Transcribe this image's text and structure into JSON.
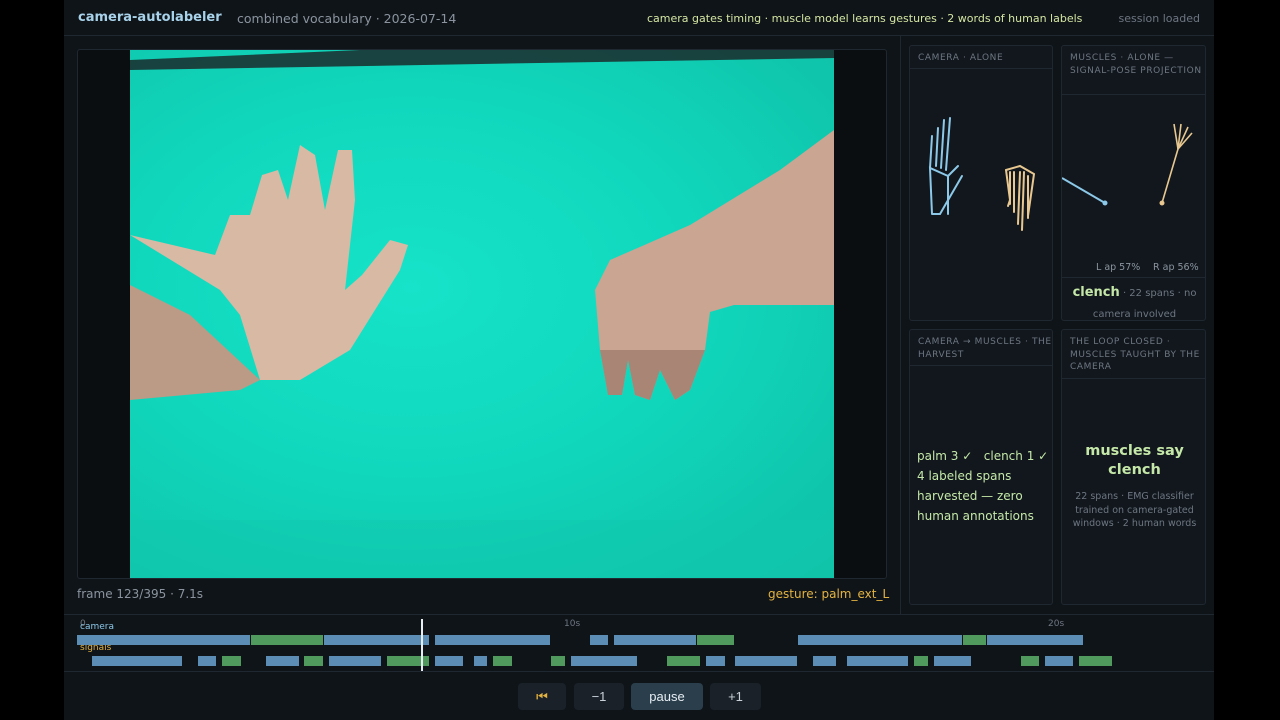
{
  "header": {
    "app_title": "camera-autolabeler",
    "subtitle": "combined vocabulary · 2026-07-14",
    "tagline": "camera gates timing · muscle model learns gestures · 2 words of human labels",
    "status": "session loaded"
  },
  "video": {
    "frame_caption": "frame 123/395 · 7.1s",
    "gesture_caption": "gesture: palm_ext_L"
  },
  "panels": {
    "camera_alone": {
      "title": "CAMERA · ALONE"
    },
    "muscles_alone": {
      "title": "MUSCLES · ALONE — SIGNAL-POSE PROJECTION",
      "ap_left": "L ap 57%",
      "ap_right": "R ap 56%",
      "word": "clench",
      "detail_inline": " · 22 spans · no",
      "detail_line2": "camera involved"
    },
    "harvest": {
      "title": "CAMERA → MUSCLES · THE HARVEST",
      "line1": "palm 3 ✓   clench 1 ✓",
      "line2": "4 labeled spans",
      "line3": "harvested — zero",
      "line4": "human annotations"
    },
    "loop_closed": {
      "title": "THE LOOP CLOSED · MUSCLES TAUGHT BY THE CAMERA",
      "headline_line1": "muscles say",
      "headline_line2": "clench",
      "detail": "22 spans · EMG classifier trained on camera-gated windows · 2 human words"
    }
  },
  "timeline": {
    "ticks": [
      "0",
      "10s",
      "20s"
    ],
    "row_camera": "camera",
    "row_signals": "signals",
    "colors": {
      "palm": "#5b8db5",
      "clench": "#4f9a5c"
    },
    "camera_segments": [
      {
        "start": 0.0,
        "end": 3.6,
        "label": "palm"
      },
      {
        "start": 3.6,
        "end": 5.1,
        "label": "clench"
      },
      {
        "start": 5.1,
        "end": 7.3,
        "label": "palm"
      },
      {
        "start": 7.4,
        "end": 9.8,
        "label": "palm"
      },
      {
        "start": 10.6,
        "end": 11.0,
        "label": "palm"
      },
      {
        "start": 11.1,
        "end": 12.8,
        "label": "palm"
      },
      {
        "start": 12.8,
        "end": 13.6,
        "label": "clench"
      },
      {
        "start": 14.9,
        "end": 18.3,
        "label": "palm"
      },
      {
        "start": 18.3,
        "end": 18.8,
        "label": "clench"
      },
      {
        "start": 18.8,
        "end": 20.8,
        "label": "palm"
      }
    ],
    "signal_segments": [
      {
        "start": 0.3,
        "end": 2.2,
        "label": "palm"
      },
      {
        "start": 2.5,
        "end": 2.9,
        "label": "palm"
      },
      {
        "start": 3.0,
        "end": 3.4,
        "label": "clench"
      },
      {
        "start": 3.9,
        "end": 4.6,
        "label": "palm"
      },
      {
        "start": 4.7,
        "end": 5.1,
        "label": "clench"
      },
      {
        "start": 5.2,
        "end": 6.3,
        "label": "palm"
      },
      {
        "start": 6.4,
        "end": 7.3,
        "label": "clench"
      },
      {
        "start": 7.4,
        "end": 8.0,
        "label": "palm"
      },
      {
        "start": 8.2,
        "end": 8.5,
        "label": "palm"
      },
      {
        "start": 8.6,
        "end": 9.0,
        "label": "clench"
      },
      {
        "start": 9.8,
        "end": 10.1,
        "label": "clench"
      },
      {
        "start": 10.2,
        "end": 11.6,
        "label": "palm"
      },
      {
        "start": 12.2,
        "end": 12.9,
        "label": "clench"
      },
      {
        "start": 13.0,
        "end": 13.4,
        "label": "palm"
      },
      {
        "start": 13.6,
        "end": 14.9,
        "label": "palm"
      },
      {
        "start": 15.2,
        "end": 15.7,
        "label": "palm"
      },
      {
        "start": 15.9,
        "end": 17.2,
        "label": "palm"
      },
      {
        "start": 17.3,
        "end": 17.6,
        "label": "clench"
      },
      {
        "start": 17.7,
        "end": 18.5,
        "label": "palm"
      },
      {
        "start": 19.5,
        "end": 19.9,
        "label": "clench"
      },
      {
        "start": 20.0,
        "end": 20.6,
        "label": "palm"
      },
      {
        "start": 20.7,
        "end": 21.4,
        "label": "clench"
      }
    ],
    "playhead_time": 7.1
  },
  "controls": {
    "rewind_icon": "⏮",
    "back_label": "−1",
    "pause_label": "pause",
    "forward_label": "+1"
  }
}
